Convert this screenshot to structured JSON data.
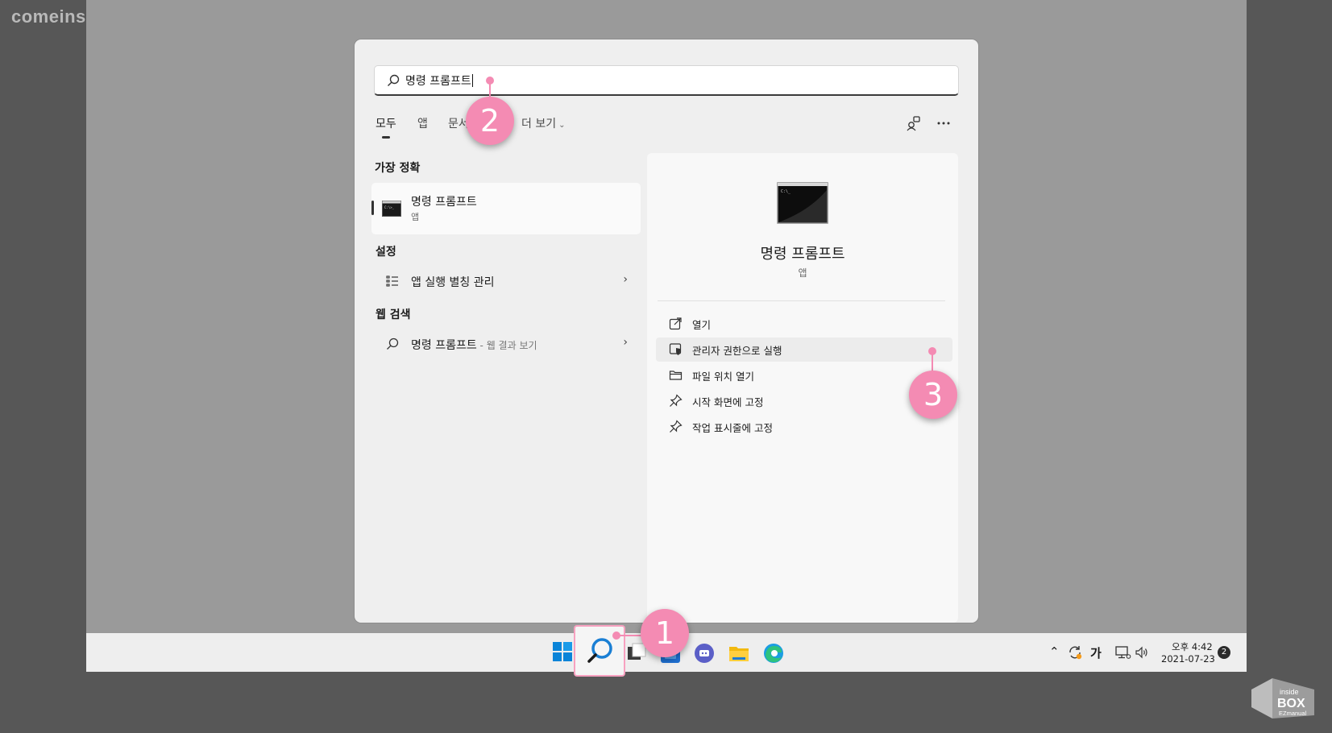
{
  "watermark": "comeinsidebox.com",
  "search": {
    "query": "명령 프롬프트"
  },
  "tabs": [
    {
      "label": "모두",
      "active": true
    },
    {
      "label": "앱"
    },
    {
      "label": "문서"
    },
    {
      "label": "더 보기"
    }
  ],
  "best_match": {
    "section": "가장 정확",
    "name": "명령 프롬프트",
    "type": "앱"
  },
  "settings": {
    "section": "설정",
    "item": "앱 실행 별칭 관리"
  },
  "web": {
    "section": "웹 검색",
    "item": "명령 프롬프트",
    "suffix": " - 웹 결과 보기"
  },
  "detail": {
    "title": "명령 프롬프트",
    "subtitle": "앱",
    "actions": [
      {
        "label": "열기",
        "icon": "open-external-icon"
      },
      {
        "label": "관리자 권한으로 실행",
        "icon": "shield-icon",
        "hovered": true
      },
      {
        "label": "파일 위치 열기",
        "icon": "folder-icon"
      },
      {
        "label": "시작 화면에 고정",
        "icon": "pin-icon"
      },
      {
        "label": "작업 표시줄에 고정",
        "icon": "pin-icon"
      }
    ]
  },
  "tray": {
    "ime": "가",
    "time": "오후 4:42",
    "date": "2021-07-23",
    "notifications": "2"
  },
  "callouts": [
    "1",
    "2",
    "3"
  ],
  "colors": {
    "callout": "#f48bb3",
    "accent": "#0078d4"
  },
  "logo": {
    "text_top": "inside",
    "text_main": "BOX",
    "text_bottom": "EZmanual"
  }
}
